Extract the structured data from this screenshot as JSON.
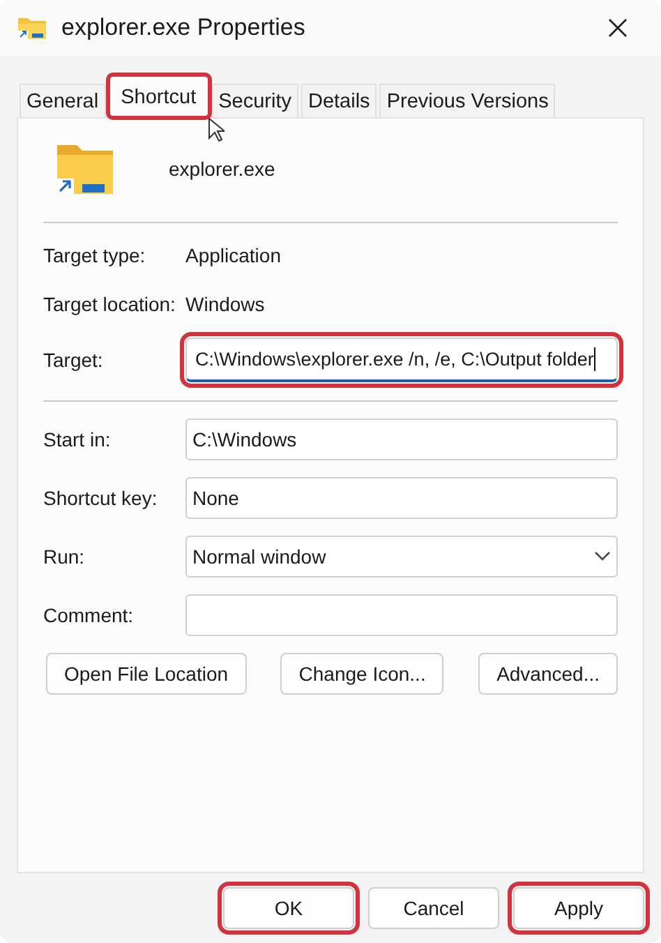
{
  "window": {
    "title": "explorer.exe Properties"
  },
  "tabs": [
    {
      "label": "General",
      "selected": false,
      "highlighted": false
    },
    {
      "label": "Shortcut",
      "selected": true,
      "highlighted": true
    },
    {
      "label": "Security",
      "selected": false,
      "highlighted": false
    },
    {
      "label": "Details",
      "selected": false,
      "highlighted": false
    },
    {
      "label": "Previous Versions",
      "selected": false,
      "highlighted": false
    }
  ],
  "shortcut": {
    "name": "explorer.exe"
  },
  "info": [
    {
      "label": "Target type:",
      "value": "Application"
    },
    {
      "label": "Target location:",
      "value": "Windows"
    }
  ],
  "target": {
    "label": "Target:",
    "value": "C:\\Windows\\explorer.exe /n, /e, C:\\Output folder",
    "highlighted": true
  },
  "fields": [
    {
      "kind": "text",
      "label": "Start in:",
      "value": "C:\\Windows"
    },
    {
      "kind": "text",
      "label": "Shortcut key:",
      "value": "None"
    },
    {
      "kind": "select",
      "label": "Run:",
      "value": "Normal window"
    },
    {
      "kind": "text",
      "label": "Comment:"
    }
  ],
  "action_buttons": [
    "Open File Location",
    "Change Icon...",
    "Advanced..."
  ],
  "dialog_buttons": [
    {
      "label": "OK",
      "highlighted": true
    },
    {
      "label": "Cancel",
      "highlighted": false
    },
    {
      "label": "Apply",
      "highlighted": true
    }
  ]
}
